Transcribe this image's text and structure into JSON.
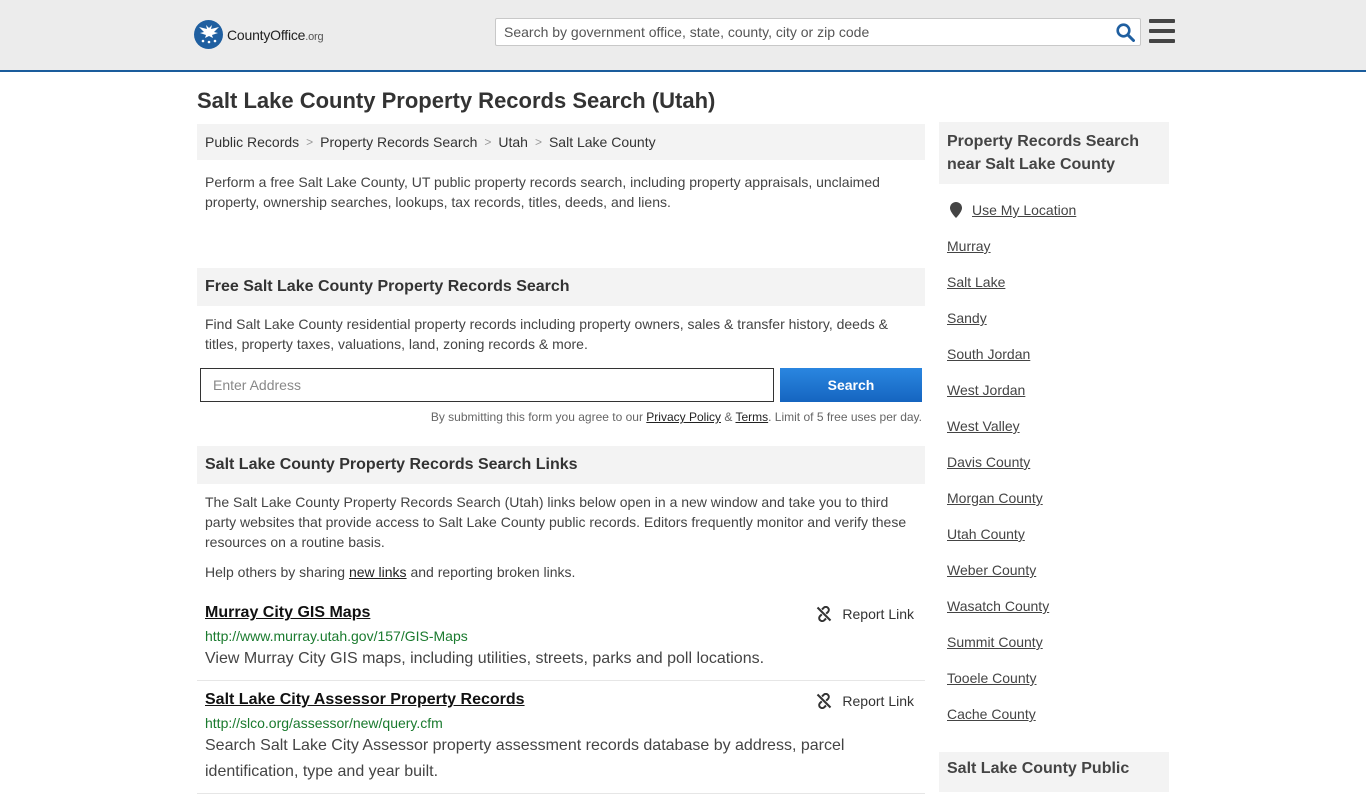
{
  "header": {
    "logo_main": "CountyOffice",
    "logo_suffix": ".org",
    "search_placeholder": "Search by government office, state, county, city or zip code"
  },
  "page": {
    "title": "Salt Lake County Property Records Search (Utah)"
  },
  "breadcrumb": [
    {
      "label": "Public Records"
    },
    {
      "label": "Property Records Search"
    },
    {
      "label": "Utah"
    },
    {
      "label": "Salt Lake County"
    }
  ],
  "intro": "Perform a free Salt Lake County, UT public property records search, including property appraisals, unclaimed property, ownership searches, lookups, tax records, titles, deeds, and liens.",
  "free_search": {
    "heading": "Free Salt Lake County Property Records Search",
    "description": "Find Salt Lake County residential property records including property owners, sales & transfer history, deeds & titles, property taxes, valuations, land, zoning records & more.",
    "address_placeholder": "Enter Address",
    "button": "Search",
    "agree_prefix": "By submitting this form you agree to our",
    "privacy": "Privacy Policy",
    "amp": "&",
    "terms": "Terms",
    "agree_suffix": ". Limit of 5 free uses per day."
  },
  "links_section": {
    "heading": "Salt Lake County Property Records Search Links",
    "description": "The Salt Lake County Property Records Search (Utah) links below open in a new window and take you to third party websites that provide access to Salt Lake County public records. Editors frequently monitor and verify these resources on a routine basis.",
    "help_prefix": "Help others by sharing",
    "help_link": "new links",
    "help_suffix": "and reporting broken links.",
    "report_label": "Report Link",
    "items": [
      {
        "title": "Murray City GIS Maps",
        "url": "http://www.murray.utah.gov/157/GIS-Maps",
        "description": "View Murray City GIS maps, including utilities, streets, parks and poll locations."
      },
      {
        "title": "Salt Lake City Assessor Property Records",
        "url": "http://slco.org/assessor/new/query.cfm",
        "description": "Search Salt Lake City Assessor property assessment records database by address, parcel identification, type and year built."
      }
    ]
  },
  "sidebar": {
    "heading": "Property Records Search near Salt Lake County",
    "use_location": "Use My Location",
    "places": [
      "Murray",
      "Salt Lake",
      "Sandy",
      "South Jordan",
      "West Jordan",
      "West Valley",
      "Davis County",
      "Morgan County",
      "Utah County",
      "Weber County",
      "Wasatch County",
      "Summit County",
      "Tooele County",
      "Cache County"
    ],
    "heading2": "Salt Lake County Public"
  },
  "colors": {
    "brand_blue": "#1f5fa0",
    "button_blue": "#1976d2",
    "url_green": "#1a7a2e"
  }
}
